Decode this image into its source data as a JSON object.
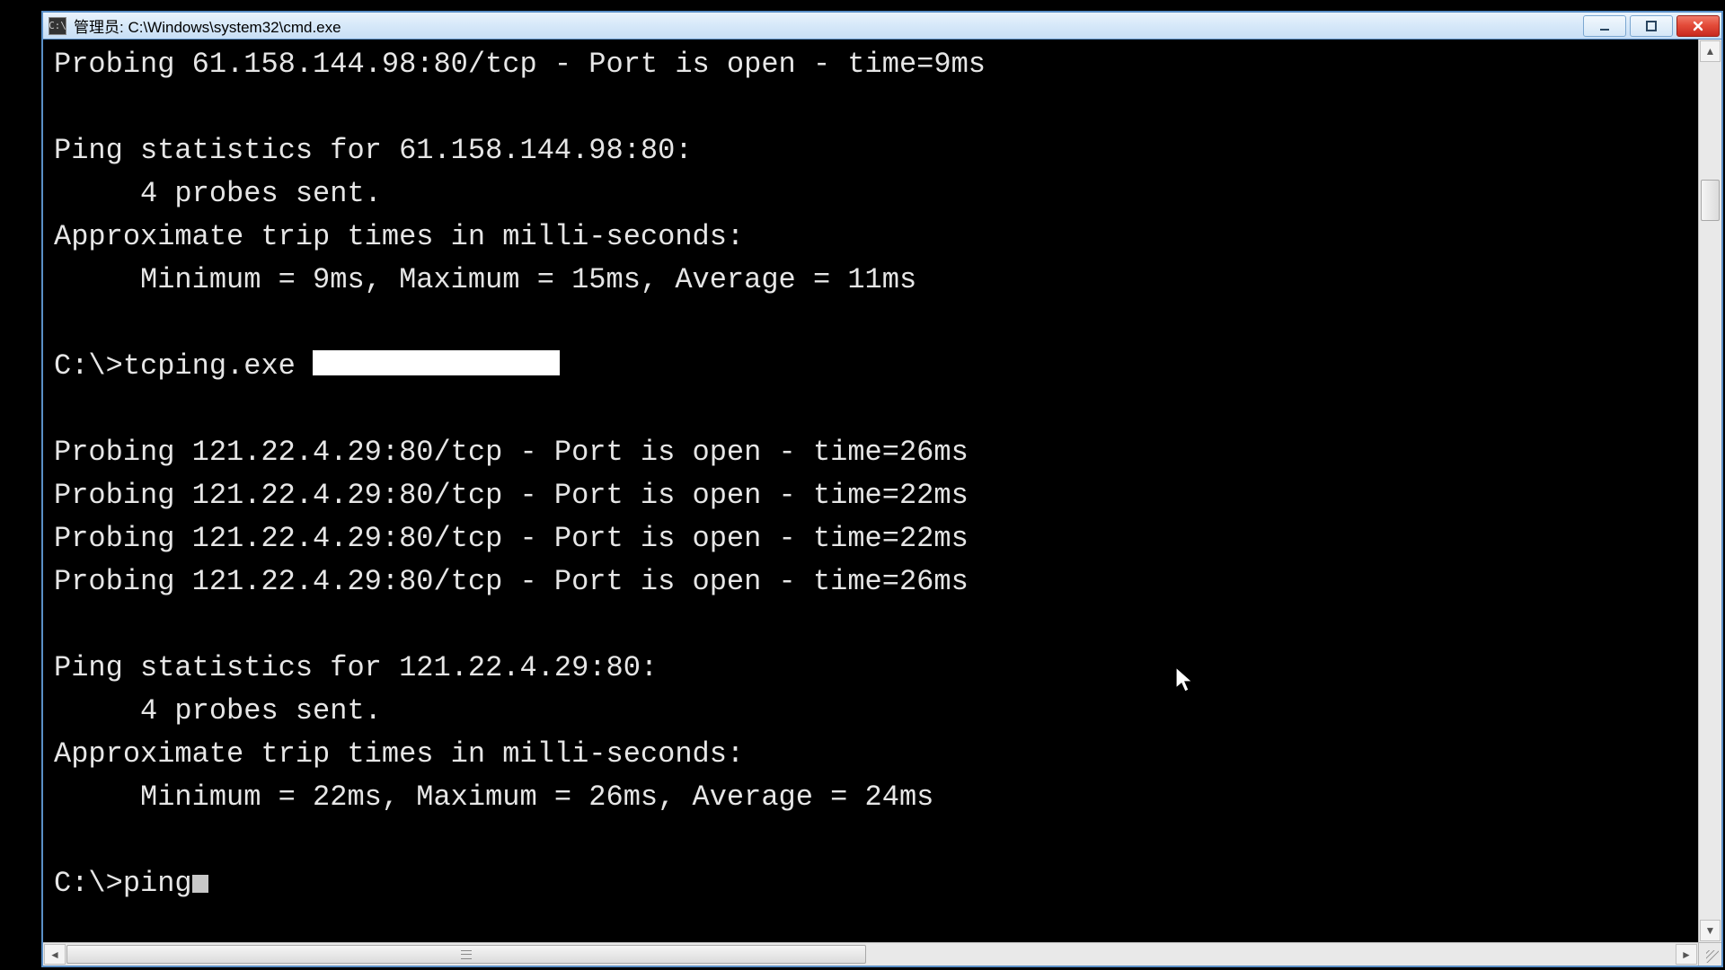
{
  "window": {
    "title": "管理员: C:\\Windows\\system32\\cmd.exe"
  },
  "terminal": {
    "line1": "Probing 61.158.144.98:80/tcp - Port is open - time=9ms",
    "line2": "",
    "line3": "Ping statistics for 61.158.144.98:80:",
    "line4": "     4 probes sent.",
    "line5": "Approximate trip times in milli-seconds:",
    "line6": "     Minimum = 9ms, Maximum = 15ms, Average = 11ms",
    "line7": "",
    "cmd1_prompt": "C:\\>tcping.exe ",
    "line9": "",
    "line10": "Probing 121.22.4.29:80/tcp - Port is open - time=26ms",
    "line11": "Probing 121.22.4.29:80/tcp - Port is open - time=22ms",
    "line12": "Probing 121.22.4.29:80/tcp - Port is open - time=22ms",
    "line13": "Probing 121.22.4.29:80/tcp - Port is open - time=26ms",
    "line14": "",
    "line15": "Ping statistics for 121.22.4.29:80:",
    "line16": "     4 probes sent.",
    "line17": "Approximate trip times in milli-seconds:",
    "line18": "     Minimum = 22ms, Maximum = 26ms, Average = 24ms",
    "line19": "",
    "cmd2_prompt": "C:\\>ping"
  }
}
